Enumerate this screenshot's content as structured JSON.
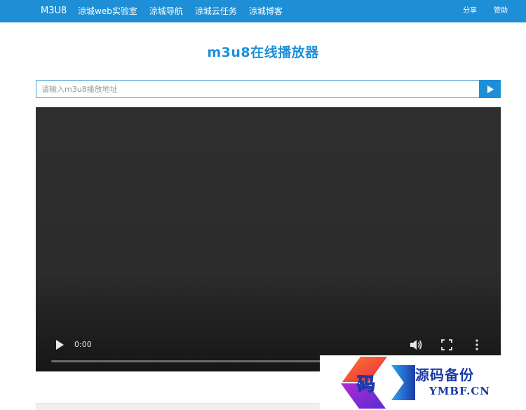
{
  "navbar": {
    "brand": "M3U8",
    "links": [
      "涼城web实验室",
      "涼城导航",
      "涼城云任务",
      "涼城博客"
    ],
    "right_links": [
      "分享",
      "赞助"
    ]
  },
  "main": {
    "title": "m3u8在线播放器",
    "url_input": {
      "value": "",
      "placeholder": "请输入m3u8播放地址"
    }
  },
  "player": {
    "current_time": "0:00",
    "progress": 0
  },
  "watermark": {
    "logo_char": "码",
    "title": "源码备份",
    "subtitle": "YMBF.CN"
  },
  "colors": {
    "accent": "#1e8fd6",
    "video_bg": "#2c2c2c",
    "watermark_text": "#1a3aa8"
  },
  "icons": {
    "submit": "play-icon",
    "video_play": "play-icon",
    "volume": "volume-icon",
    "fullscreen": "fullscreen-icon",
    "more": "more-vertical-icon"
  }
}
